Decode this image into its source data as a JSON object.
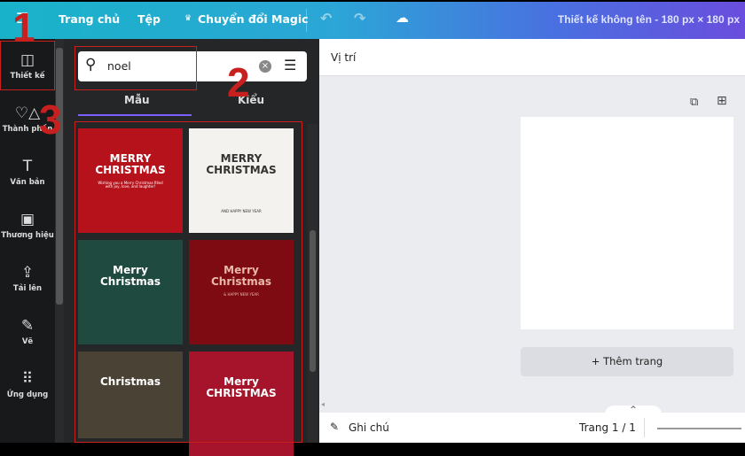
{
  "topbar": {
    "menu_icon": "hamburger-icon",
    "home": "Trang chủ",
    "file": "Tệp",
    "magic": "Chuyển đổi Magic",
    "title": "Thiết kế không tên - 180 px × 180 px",
    "gradient": [
      "#19b3c9",
      "#6a4ddd"
    ]
  },
  "rail": [
    {
      "icon": "layout-icon",
      "label": "Thiết kế"
    },
    {
      "icon": "elements-icon",
      "label": "Thành phần"
    },
    {
      "icon": "text-icon",
      "label": "Văn bản"
    },
    {
      "icon": "brand-icon",
      "label": "Thương hiệu"
    },
    {
      "icon": "upload-icon",
      "label": "Tải lên"
    },
    {
      "icon": "draw-icon",
      "label": "Vẽ"
    },
    {
      "icon": "apps-icon",
      "label": "Ứng dụng"
    }
  ],
  "search": {
    "value": "noel"
  },
  "tabs": [
    {
      "label": "Mẫu",
      "active": true
    },
    {
      "label": "Kiểu"
    }
  ],
  "templates": [
    {
      "title": "MERRY\nCHRISTMAS",
      "sub": "Wishing you a Merry Christmas filled with joy, love, and laughter!",
      "bg": "#b5121b",
      "fg": "#ffffff"
    },
    {
      "title": "MERRY\nCHRISTMAS",
      "sub": "AND HAPPY NEW YEAR",
      "bg": "#f4f2ef",
      "fg": "#333333"
    },
    {
      "title": "Merry\nChristmas",
      "bg": "#1f4a3f",
      "fg": "#ffffff"
    },
    {
      "title": "Merry\nChristmas",
      "sub": "& HAPPY NEW YEAR",
      "bg": "#7e0a12",
      "fg": "#e8b9a8"
    },
    {
      "title": "Christmas",
      "bg": "#4b4236",
      "fg": "#ffffff"
    },
    {
      "title": "Merry\nCHRISTMAS",
      "bg": "#a5142a",
      "fg": "#ffffff"
    }
  ],
  "toolbar": {
    "position": "Vị trí"
  },
  "canvas": {
    "add_page": "+ Thêm trang"
  },
  "bottom": {
    "notes": "Ghi chú",
    "page": "Trang 1 / 1"
  },
  "annotations": [
    "1",
    "2",
    "3"
  ],
  "annotation_color": "#c8201e"
}
